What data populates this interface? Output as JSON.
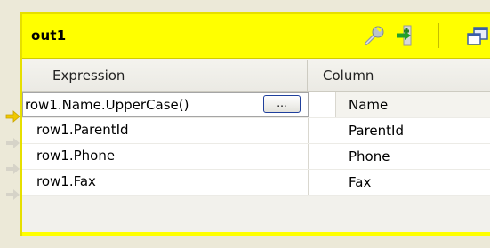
{
  "panel": {
    "title": "out1",
    "accent_color": "#ffff00",
    "toolbar": {
      "icons": [
        "wrench-icon",
        "add-column-icon",
        "view-icon"
      ]
    }
  },
  "table": {
    "headers": {
      "expression": "Expression",
      "column": "Column"
    },
    "rows": [
      {
        "expression": "row1.Name.UpperCase()",
        "column": "Name",
        "selected": true,
        "button_label": "..."
      },
      {
        "expression": "row1.ParentId",
        "column": "ParentId",
        "selected": false
      },
      {
        "expression": "row1.Phone",
        "column": "Phone",
        "selected": false
      },
      {
        "expression": "row1.Fax",
        "column": "Fax",
        "selected": false
      }
    ]
  }
}
